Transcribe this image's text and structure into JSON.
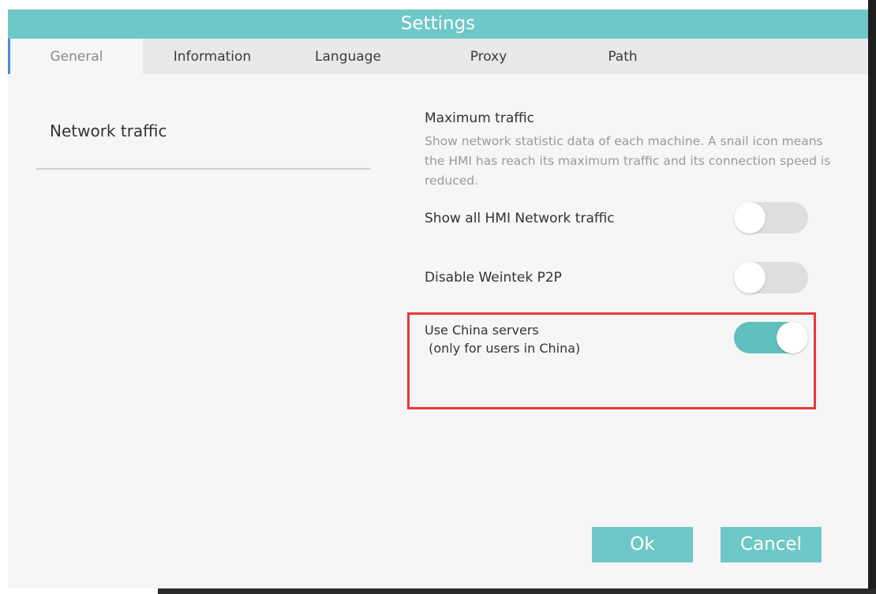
{
  "window": {
    "title": "Settings"
  },
  "tabs": [
    {
      "label": "General",
      "active": true
    },
    {
      "label": "Information",
      "active": false
    },
    {
      "label": "Language",
      "active": false
    },
    {
      "label": "Proxy",
      "active": false
    },
    {
      "label": "Path",
      "active": false
    }
  ],
  "sidebar": {
    "heading": "Network traffic"
  },
  "network": {
    "title": "Maximum traffic",
    "description": "Show network statistic data of each machine. A snail icon means the HMI has reach its maximum traffic and its connection speed is reduced.",
    "options": [
      {
        "label": "Show all HMI Network traffic",
        "enabled": false
      },
      {
        "label": "Disable Weintek P2P",
        "enabled": false
      },
      {
        "label_line1": "Use China servers",
        "label_line2": " (only for users in China)",
        "enabled": true
      }
    ]
  },
  "footer": {
    "ok_label": "Ok",
    "cancel_label": "Cancel"
  },
  "colors": {
    "accent": "#6fc8c8",
    "toggle_on": "#5fc0bd",
    "toggle_off": "#dedede",
    "highlight": "#e53939"
  }
}
